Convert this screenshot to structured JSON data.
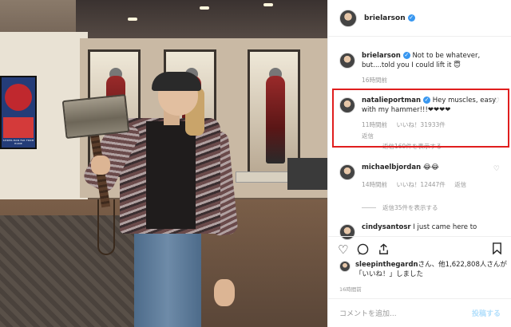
{
  "post": {
    "username": "brielarson",
    "caption_user": "brielarson",
    "caption_text": "Not to be whatever, but....told you I could lift it 😇",
    "caption_time": "16時間前"
  },
  "photo": {
    "poster_label": "SPIDER-MAN FAR FROM HOME"
  },
  "comments": [
    {
      "user": "natalieportman",
      "text": "Hey muscles, easy with my hammer!!!❤❤❤❤",
      "time": "11時間前",
      "likes": "いいね！31933件",
      "reply": "返信",
      "view_replies": "返信169件を表示する"
    },
    {
      "user": "michaelbjordan",
      "text": "😂😂",
      "time": "14時間前",
      "likes": "いいね！12447件",
      "reply": "返信",
      "view_replies": "返信35件を表示する"
    },
    {
      "user": "cindysantosr",
      "text": "I just came here to"
    }
  ],
  "likes": {
    "user": "sleepinthegardn",
    "text": "さん、他1,622,808人さんが「いいね！」しました"
  },
  "post_time": "16時間前",
  "comment_box": {
    "placeholder": "コメントを追加...",
    "post_label": "投稿する"
  },
  "icons": {
    "like": "heart-icon",
    "comment": "comment-icon",
    "share": "share-icon",
    "save": "bookmark-icon",
    "verified": "verified-badge-icon"
  },
  "colors": {
    "verified": "#3897f0",
    "highlight": "#e01e1e",
    "muted_text": "#999999",
    "post_button": "#b2dffc"
  }
}
